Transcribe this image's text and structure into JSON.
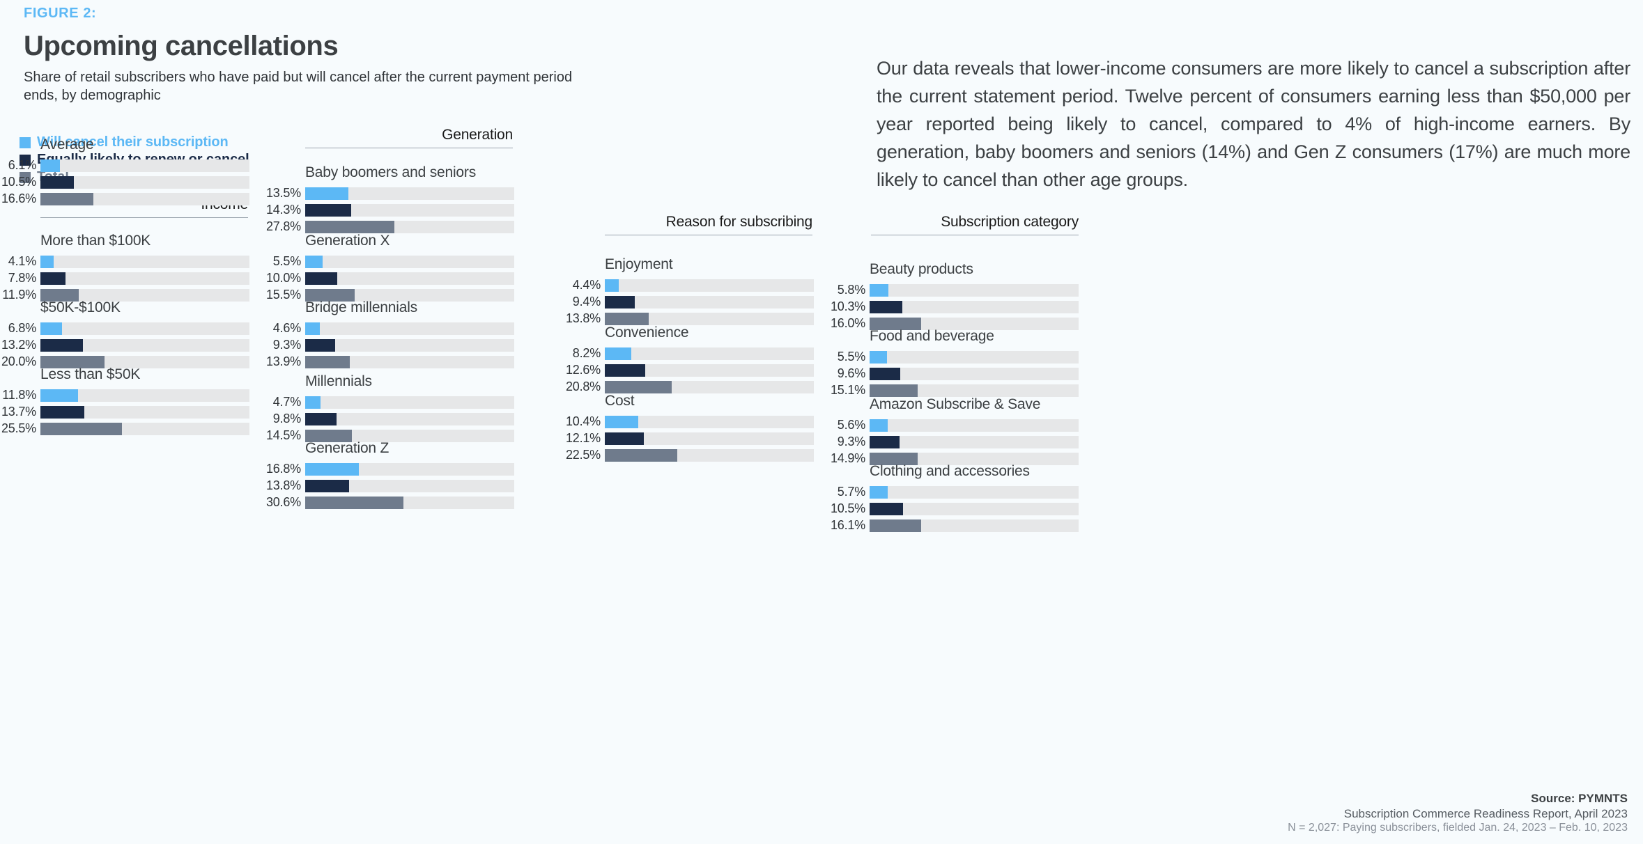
{
  "header": {
    "figure_label": "FIGURE 2:",
    "title": "Upcoming cancellations",
    "subtitle": "Share of retail subscribers who have paid but will cancel after the current payment period ends, by demographic"
  },
  "legend": [
    {
      "label": "Will cancel their subscription",
      "color": "#5cb8f5"
    },
    {
      "label": "Equally likely to renew or cancel",
      "color": "#1b2b47"
    },
    {
      "label": "Total",
      "color": "#6f7b8c"
    }
  ],
  "section_headings": {
    "income": "Income",
    "generation": "Generation",
    "reason": "Reason for subscribing",
    "category": "Subscription category"
  },
  "body_copy": "Our data reveals that lower-income consumers are more likely to cancel a subscription after the current statement period. Twelve percent of consumers earning less than $50,000 per year reported being likely to cancel, compared to 4% of high-income earners. By generation, baby boomers and seniors (14%) and Gen Z consumers (17%) are much more likely to cancel than other age groups.",
  "footer": {
    "source": "Source: PYMNTS",
    "report": "Subscription Commerce Readiness Report, April 2023",
    "sample": "N = 2,027: Paying subscribers, fielded Jan. 24, 2023 – Feb. 10, 2023"
  },
  "chart_data": {
    "type": "bar",
    "title": "Upcoming cancellations",
    "subtitle": "Share of retail subscribers who have paid but will cancel after the current payment period ends, by demographic",
    "orientation": "horizontal",
    "value_unit": "percent",
    "axis_max": 100,
    "grid": false,
    "legend_position": "top-left",
    "series_names": [
      "Will cancel their subscription",
      "Equally likely to renew or cancel",
      "Total"
    ],
    "series_colors": [
      "#5cb8f5",
      "#1b2b47",
      "#6f7b8c"
    ],
    "groups": [
      {
        "section": "",
        "name": "Average",
        "values": [
          6.1,
          10.5,
          16.6
        ],
        "labels": [
          "6.1%",
          "10.5%",
          "16.6%"
        ]
      },
      {
        "section": "Income",
        "name": "More than $100K",
        "values": [
          4.1,
          7.8,
          11.9
        ],
        "labels": [
          "4.1%",
          "7.8%",
          "11.9%"
        ]
      },
      {
        "section": "Income",
        "name": "$50K-$100K",
        "values": [
          6.8,
          13.2,
          20.0
        ],
        "labels": [
          "6.8%",
          "13.2%",
          "20.0%"
        ]
      },
      {
        "section": "Income",
        "name": "Less than $50K",
        "values": [
          11.8,
          13.7,
          25.5
        ],
        "labels": [
          "11.8%",
          "13.7%",
          "25.5%"
        ]
      },
      {
        "section": "Generation",
        "name": "Baby boomers and seniors",
        "values": [
          13.5,
          14.3,
          27.8
        ],
        "labels": [
          "13.5%",
          "14.3%",
          "27.8%"
        ]
      },
      {
        "section": "Generation",
        "name": "Generation X",
        "values": [
          5.5,
          10.0,
          15.5
        ],
        "labels": [
          "5.5%",
          "10.0%",
          "15.5%"
        ]
      },
      {
        "section": "Generation",
        "name": "Bridge millennials",
        "values": [
          4.6,
          9.3,
          13.9
        ],
        "labels": [
          "4.6%",
          "9.3%",
          "13.9%"
        ]
      },
      {
        "section": "Generation",
        "name": "Millennials",
        "values": [
          4.7,
          9.8,
          14.5
        ],
        "labels": [
          "4.7%",
          "9.8%",
          "14.5%"
        ]
      },
      {
        "section": "Generation",
        "name": "Generation Z",
        "values": [
          16.8,
          13.8,
          30.6
        ],
        "labels": [
          "16.8%",
          "13.8%",
          "30.6%"
        ]
      },
      {
        "section": "Reason for subscribing",
        "name": "Enjoyment",
        "values": [
          4.4,
          9.4,
          13.8
        ],
        "labels": [
          "4.4%",
          "9.4%",
          "13.8%"
        ]
      },
      {
        "section": "Reason for subscribing",
        "name": "Convenience",
        "values": [
          8.2,
          12.6,
          20.8
        ],
        "labels": [
          "8.2%",
          "12.6%",
          "20.8%"
        ]
      },
      {
        "section": "Reason for subscribing",
        "name": "Cost",
        "values": [
          10.4,
          12.1,
          22.5
        ],
        "labels": [
          "10.4%",
          "12.1%",
          "22.5%"
        ]
      },
      {
        "section": "Subscription category",
        "name": "Beauty products",
        "values": [
          5.8,
          10.3,
          16.0
        ],
        "labels": [
          "5.8%",
          "10.3%",
          "16.0%"
        ]
      },
      {
        "section": "Subscription category",
        "name": "Food and beverage",
        "values": [
          5.5,
          9.6,
          15.1
        ],
        "labels": [
          "5.5%",
          "9.6%",
          "15.1%"
        ]
      },
      {
        "section": "Subscription category",
        "name": "Amazon Subscribe & Save",
        "values": [
          5.6,
          9.3,
          14.9
        ],
        "labels": [
          "5.6%",
          "9.3%",
          "14.9%"
        ]
      },
      {
        "section": "Subscription category",
        "name": "Clothing and accessories",
        "values": [
          5.7,
          10.5,
          16.1
        ],
        "labels": [
          "5.7%",
          "10.5%",
          "16.1%"
        ]
      }
    ]
  }
}
